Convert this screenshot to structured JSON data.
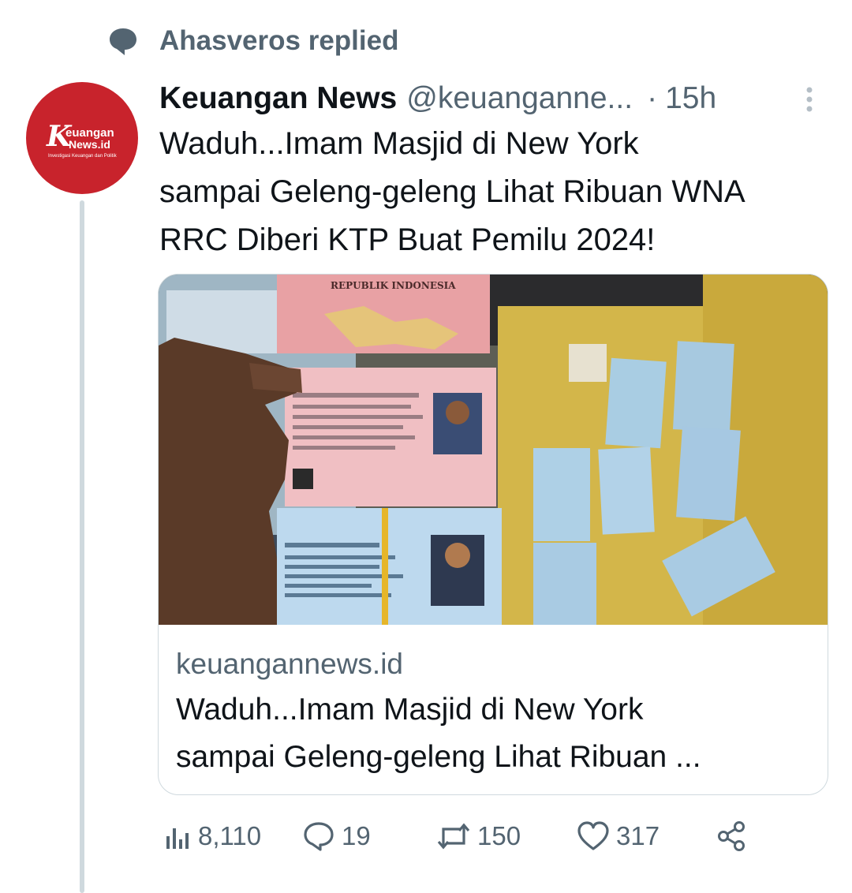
{
  "reply_context": {
    "icon": "chat-bubble-icon",
    "text": "Ahasveros replied"
  },
  "author": {
    "avatar_logo_lines": [
      "K",
      "euangan",
      "News.id",
      "Investigasi Keuangan dan Politik"
    ],
    "name": "Keuangan News",
    "handle": "@keuanganne...",
    "separator": "·",
    "time": "15h"
  },
  "tweet": {
    "text_lines": [
      "Waduh...Imam Masjid di New York",
      "sampai Geleng-geleng Lihat Ribuan WNA",
      "RRC Diberi KTP Buat Pemilu 2024!"
    ]
  },
  "card": {
    "image_ktp_header": "REPUBLIK INDONESIA",
    "domain": "keuangannews.id",
    "title_lines": [
      "Waduh...Imam Masjid di New York",
      "sampai Geleng-geleng Lihat Ribuan ..."
    ]
  },
  "actions": {
    "views": "8,110",
    "replies": "19",
    "retweets": "150",
    "likes": "317"
  },
  "colors": {
    "secondary_text": "#536471",
    "brand_red": "#c8232c",
    "border": "#cfd9de"
  }
}
